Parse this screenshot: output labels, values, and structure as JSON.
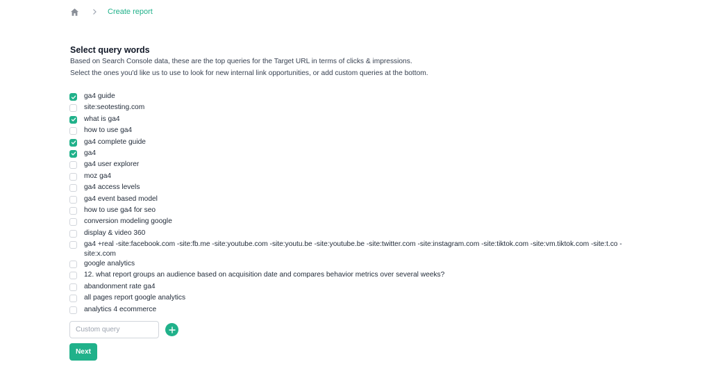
{
  "breadcrumb": {
    "home_icon": "home-icon",
    "separator_icon": "chevron-right-icon",
    "current": "Create report"
  },
  "section": {
    "title": "Select query words",
    "description_line1": "Based on Search Console data, these are the top queries for the Target URL in terms of clicks & impressions.",
    "description_line2": "Select the ones you'd like us to use to look for new internal link opportunities, or add custom queries at the bottom."
  },
  "queries": [
    {
      "label": "ga4 guide",
      "checked": true
    },
    {
      "label": "site:seotesting.com",
      "checked": false
    },
    {
      "label": "what is ga4",
      "checked": true
    },
    {
      "label": "how to use ga4",
      "checked": false
    },
    {
      "label": "ga4 complete guide",
      "checked": true
    },
    {
      "label": "ga4",
      "checked": true
    },
    {
      "label": "ga4 user explorer",
      "checked": false
    },
    {
      "label": "moz ga4",
      "checked": false
    },
    {
      "label": "ga4 access levels",
      "checked": false
    },
    {
      "label": "ga4 event based model",
      "checked": false
    },
    {
      "label": "how to use ga4 for seo",
      "checked": false
    },
    {
      "label": "conversion modeling google",
      "checked": false
    },
    {
      "label": "display & video 360",
      "checked": false
    },
    {
      "label": "ga4 +real -site:facebook.com -site:fb.me -site:youtube.com -site:youtu.be -site:youtube.be -site:twitter.com -site:instagram.com -site:tiktok.com -site:vm.tiktok.com -site:t.co -site:x.com",
      "checked": false
    },
    {
      "label": "google analytics",
      "checked": false
    },
    {
      "label": "12. what report groups an audience based on acquisition date and compares behavior metrics over several weeks?",
      "checked": false
    },
    {
      "label": "abandonment rate ga4",
      "checked": false
    },
    {
      "label": "all pages report google analytics",
      "checked": false
    },
    {
      "label": "analytics 4 ecommerce",
      "checked": false
    }
  ],
  "custom_query": {
    "placeholder": "Custom query",
    "value": "",
    "add_icon": "plus-icon"
  },
  "actions": {
    "next_label": "Next"
  },
  "colors": {
    "accent": "#20b18a",
    "text": "#1f2937",
    "muted": "#9ca3af",
    "border": "#d1d5db"
  }
}
